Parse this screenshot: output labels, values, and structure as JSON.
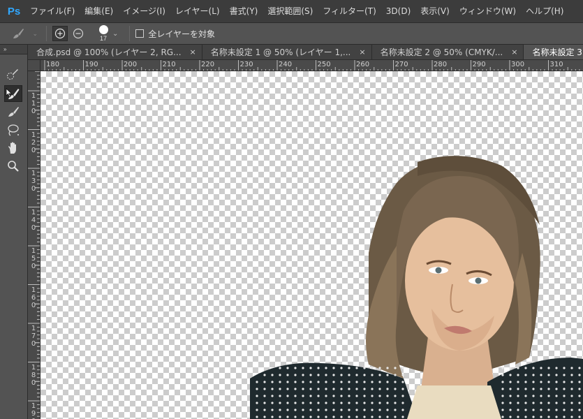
{
  "app": {
    "logo": "Ps"
  },
  "menu": [
    "ファイル(F)",
    "編集(E)",
    "イメージ(I)",
    "レイヤー(L)",
    "書式(Y)",
    "選択範囲(S)",
    "フィルター(T)",
    "3D(D)",
    "表示(V)",
    "ウィンドウ(W)",
    "ヘルプ(H)"
  ],
  "options": {
    "brush_size": "17",
    "sample_all_layers_label": "全レイヤーを対象",
    "sample_all_layers_checked": false
  },
  "toolbar": {
    "collapse_glyph": "»",
    "tools": [
      "quick-selection-tool",
      "brush-tool",
      "quick-selection-alt-tool",
      "lasso-tool",
      "hand-tool",
      "zoom-tool"
    ],
    "active_tool": "brush-tool"
  },
  "tabs": [
    {
      "label": "合成.psd @ 100% (レイヤー 2, RG...",
      "active": false
    },
    {
      "label": "名称未設定 1 @ 50% (レイヤー 1,...",
      "active": false
    },
    {
      "label": "名称未設定 2 @ 50% (CMYK/...",
      "active": false
    },
    {
      "label": "名称未設定 3 @ 66.7%",
      "active": true
    }
  ],
  "tab_close_glyph": "×",
  "ruler_top": [
    "180",
    "190",
    "200",
    "210",
    "220",
    "230",
    "240",
    "250",
    "260",
    "270",
    "280",
    "290",
    "300",
    "310"
  ],
  "ruler_left": [
    "110",
    "120",
    "130",
    "140",
    "150",
    "160",
    "170",
    "180",
    "190"
  ],
  "colors": {
    "accent": "#31a8ff",
    "menubar_bg": "#3c3c3c",
    "panel_bg": "#535353",
    "checker_light": "#ffffff",
    "checker_dark": "#cccccc"
  }
}
